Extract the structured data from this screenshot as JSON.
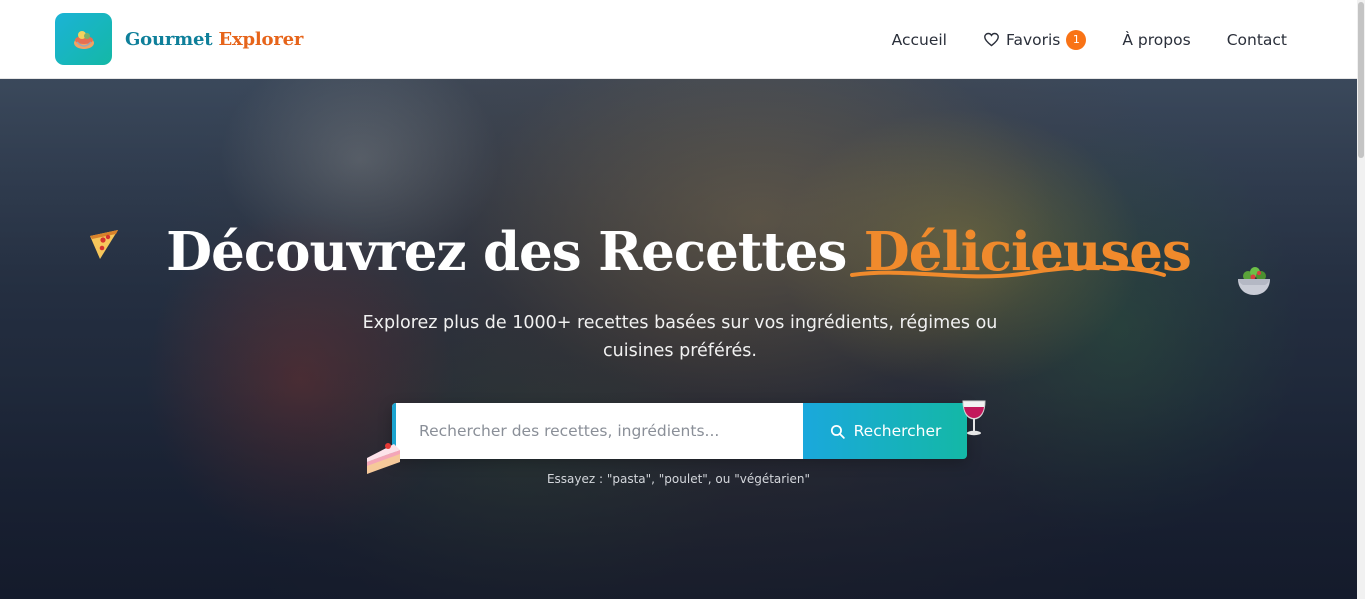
{
  "brand": {
    "part1": "Gourmet",
    "part2": "Explorer"
  },
  "nav": {
    "home": "Accueil",
    "favorites": "Favoris",
    "favorites_count": "1",
    "about": "À propos",
    "contact": "Contact"
  },
  "hero": {
    "title_main": "Découvrez des Recettes ",
    "title_accent": "Délicieuses",
    "subtitle": "Explorez plus de 1000+ recettes basées sur vos ingrédients, régimes ou cuisines préférés.",
    "search_placeholder": "Rechercher des recettes, ingrédients...",
    "search_button": "Rechercher",
    "hint": "Essayez : \"pasta\", \"poulet\", ou \"végétarien\""
  },
  "icons": [
    "pizza-icon",
    "salad-bowl-icon",
    "wine-glass-icon",
    "cake-slice-icon",
    "search-icon",
    "heart-icon",
    "logo-icon"
  ],
  "colors": {
    "accent_orange": "#f97316",
    "accent_teal": "#14b8a6",
    "accent_blue": "#1aa8dc"
  }
}
